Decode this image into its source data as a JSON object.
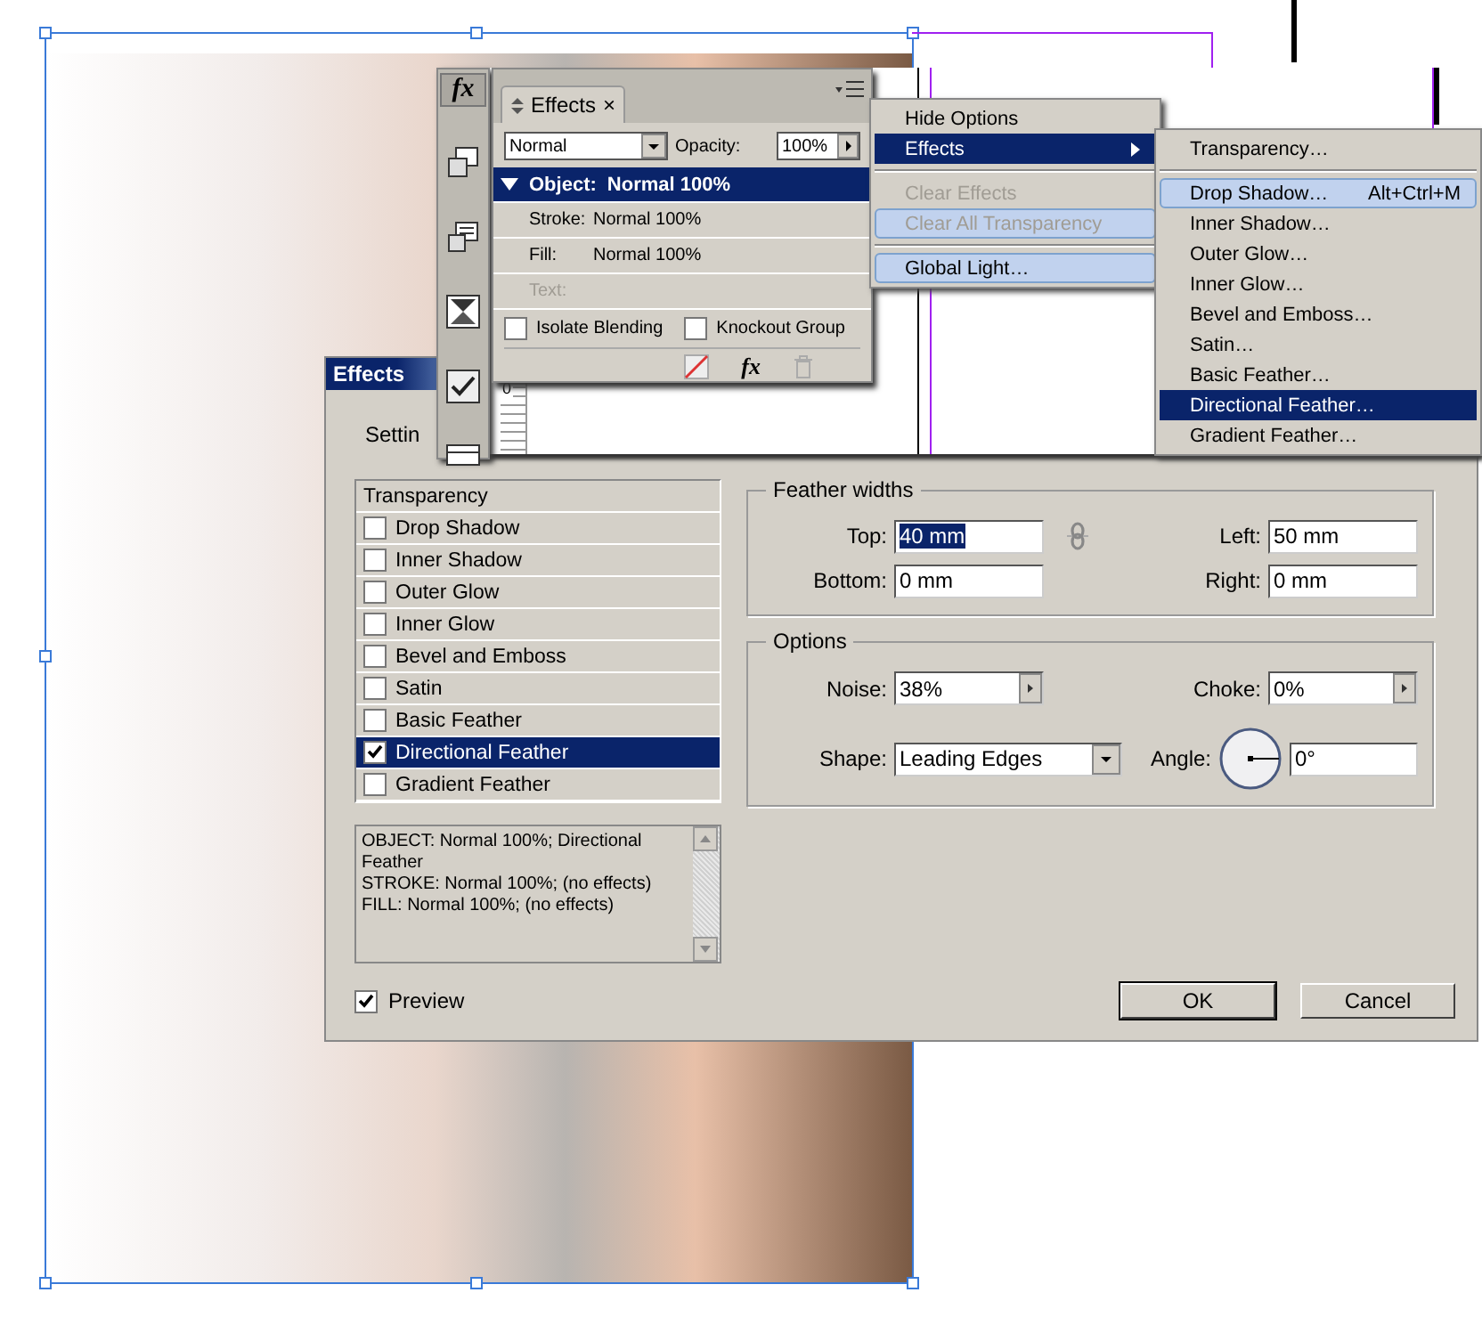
{
  "toolbar": {
    "fx_label": "fx"
  },
  "document": {
    "ruler_label": "0"
  },
  "panel": {
    "tab": "Effects",
    "close": "×",
    "blend_mode": "Normal",
    "opacity_label": "Opacity:",
    "opacity": "100%",
    "rows": [
      {
        "label": "Object:",
        "value": "Normal 100%",
        "selected": true,
        "disabled": false
      },
      {
        "label": "Stroke:",
        "value": "Normal 100%",
        "selected": false,
        "disabled": false
      },
      {
        "label": "Fill:",
        "value": "Normal 100%",
        "selected": false,
        "disabled": false
      },
      {
        "label": "Text:",
        "selected": false,
        "disabled": true
      }
    ],
    "checkboxes": [
      {
        "label": "Isolate Blending",
        "checked": false
      },
      {
        "label": "Knockout Group",
        "checked": false
      }
    ],
    "footer_fx": "fx"
  },
  "menu": {
    "items": [
      {
        "kind": "item",
        "label": "Hide Options",
        "selected": false,
        "hovered": false,
        "disabled": false
      },
      {
        "kind": "submenu",
        "label": "Effects",
        "selected": true,
        "hovered": false,
        "disabled": false
      },
      {
        "kind": "separator"
      },
      {
        "kind": "item",
        "label": "Clear Effects",
        "selected": false,
        "hovered": false,
        "disabled": true
      },
      {
        "kind": "item",
        "label": "Clear All Transparency",
        "selected": false,
        "hovered": true,
        "disabled": true
      },
      {
        "kind": "separator"
      },
      {
        "kind": "item",
        "label": "Global Light…",
        "selected": false,
        "hovered": true,
        "disabled": false
      }
    ]
  },
  "submenu": {
    "items": [
      {
        "kind": "item",
        "label": "Transparency…",
        "selected": false,
        "hovered": false
      },
      {
        "kind": "separator"
      },
      {
        "kind": "item",
        "label": "Drop Shadow…",
        "shortcut": "Alt+Ctrl+M",
        "selected": false,
        "hovered": true
      },
      {
        "kind": "item",
        "label": "Inner Shadow…",
        "selected": false,
        "hovered": false
      },
      {
        "kind": "item",
        "label": "Outer Glow…",
        "selected": false,
        "hovered": false
      },
      {
        "kind": "item",
        "label": "Inner Glow…",
        "selected": false,
        "hovered": false
      },
      {
        "kind": "item",
        "label": "Bevel and Emboss…",
        "selected": false,
        "hovered": false
      },
      {
        "kind": "item",
        "label": "Satin…",
        "selected": false,
        "hovered": false
      },
      {
        "kind": "item",
        "label": "Basic Feather…",
        "selected": false,
        "hovered": false
      },
      {
        "kind": "item",
        "label": "Directional Feather…",
        "selected": true,
        "hovered": false
      },
      {
        "kind": "item",
        "label": "Gradient Feather…",
        "selected": false,
        "hovered": false
      }
    ]
  },
  "dialog": {
    "title": "Effects",
    "settings_label": "Settin",
    "effects": [
      {
        "kind": "header",
        "label": "Transparency",
        "selected": false
      },
      {
        "kind": "check",
        "label": "Drop Shadow",
        "checked": false,
        "selected": false
      },
      {
        "kind": "check",
        "label": "Inner Shadow",
        "checked": false,
        "selected": false
      },
      {
        "kind": "check",
        "label": "Outer Glow",
        "checked": false,
        "selected": false
      },
      {
        "kind": "check",
        "label": "Inner Glow",
        "checked": false,
        "selected": false
      },
      {
        "kind": "check",
        "label": "Bevel and Emboss",
        "checked": false,
        "selected": false
      },
      {
        "kind": "check",
        "label": "Satin",
        "checked": false,
        "selected": false
      },
      {
        "kind": "check",
        "label": "Basic Feather",
        "checked": false,
        "selected": false
      },
      {
        "kind": "check",
        "label": "Directional Feather",
        "checked": true,
        "selected": true
      },
      {
        "kind": "check",
        "label": "Gradient Feather",
        "checked": false,
        "selected": false
      }
    ],
    "summary": [
      "OBJECT: Normal 100%; Directional Feather",
      "STROKE: Normal 100%; (no effects)",
      "FILL: Normal 100%; (no effects)"
    ],
    "preview": {
      "label": "Preview",
      "checked": true
    },
    "feather": {
      "title": "Feather widths",
      "fields": [
        {
          "label": "Top:",
          "value": "40 mm",
          "text_selected": true
        },
        {
          "label": "Left:",
          "value": "50 mm",
          "text_selected": false
        },
        {
          "label": "Bottom:",
          "value": "0 mm",
          "text_selected": false
        },
        {
          "label": "Right:",
          "value": "0 mm",
          "text_selected": false
        }
      ]
    },
    "options": {
      "title": "Options",
      "fields": [
        {
          "kind": "spinner",
          "label": "Noise:",
          "value": "38%"
        },
        {
          "kind": "spinner",
          "label": "Choke:",
          "value": "0%"
        },
        {
          "kind": "select",
          "label": "Shape:",
          "value": "Leading Edges"
        },
        {
          "kind": "angle",
          "label": "Angle:",
          "value": "0°"
        }
      ]
    },
    "buttons": [
      "OK",
      "Cancel"
    ]
  }
}
